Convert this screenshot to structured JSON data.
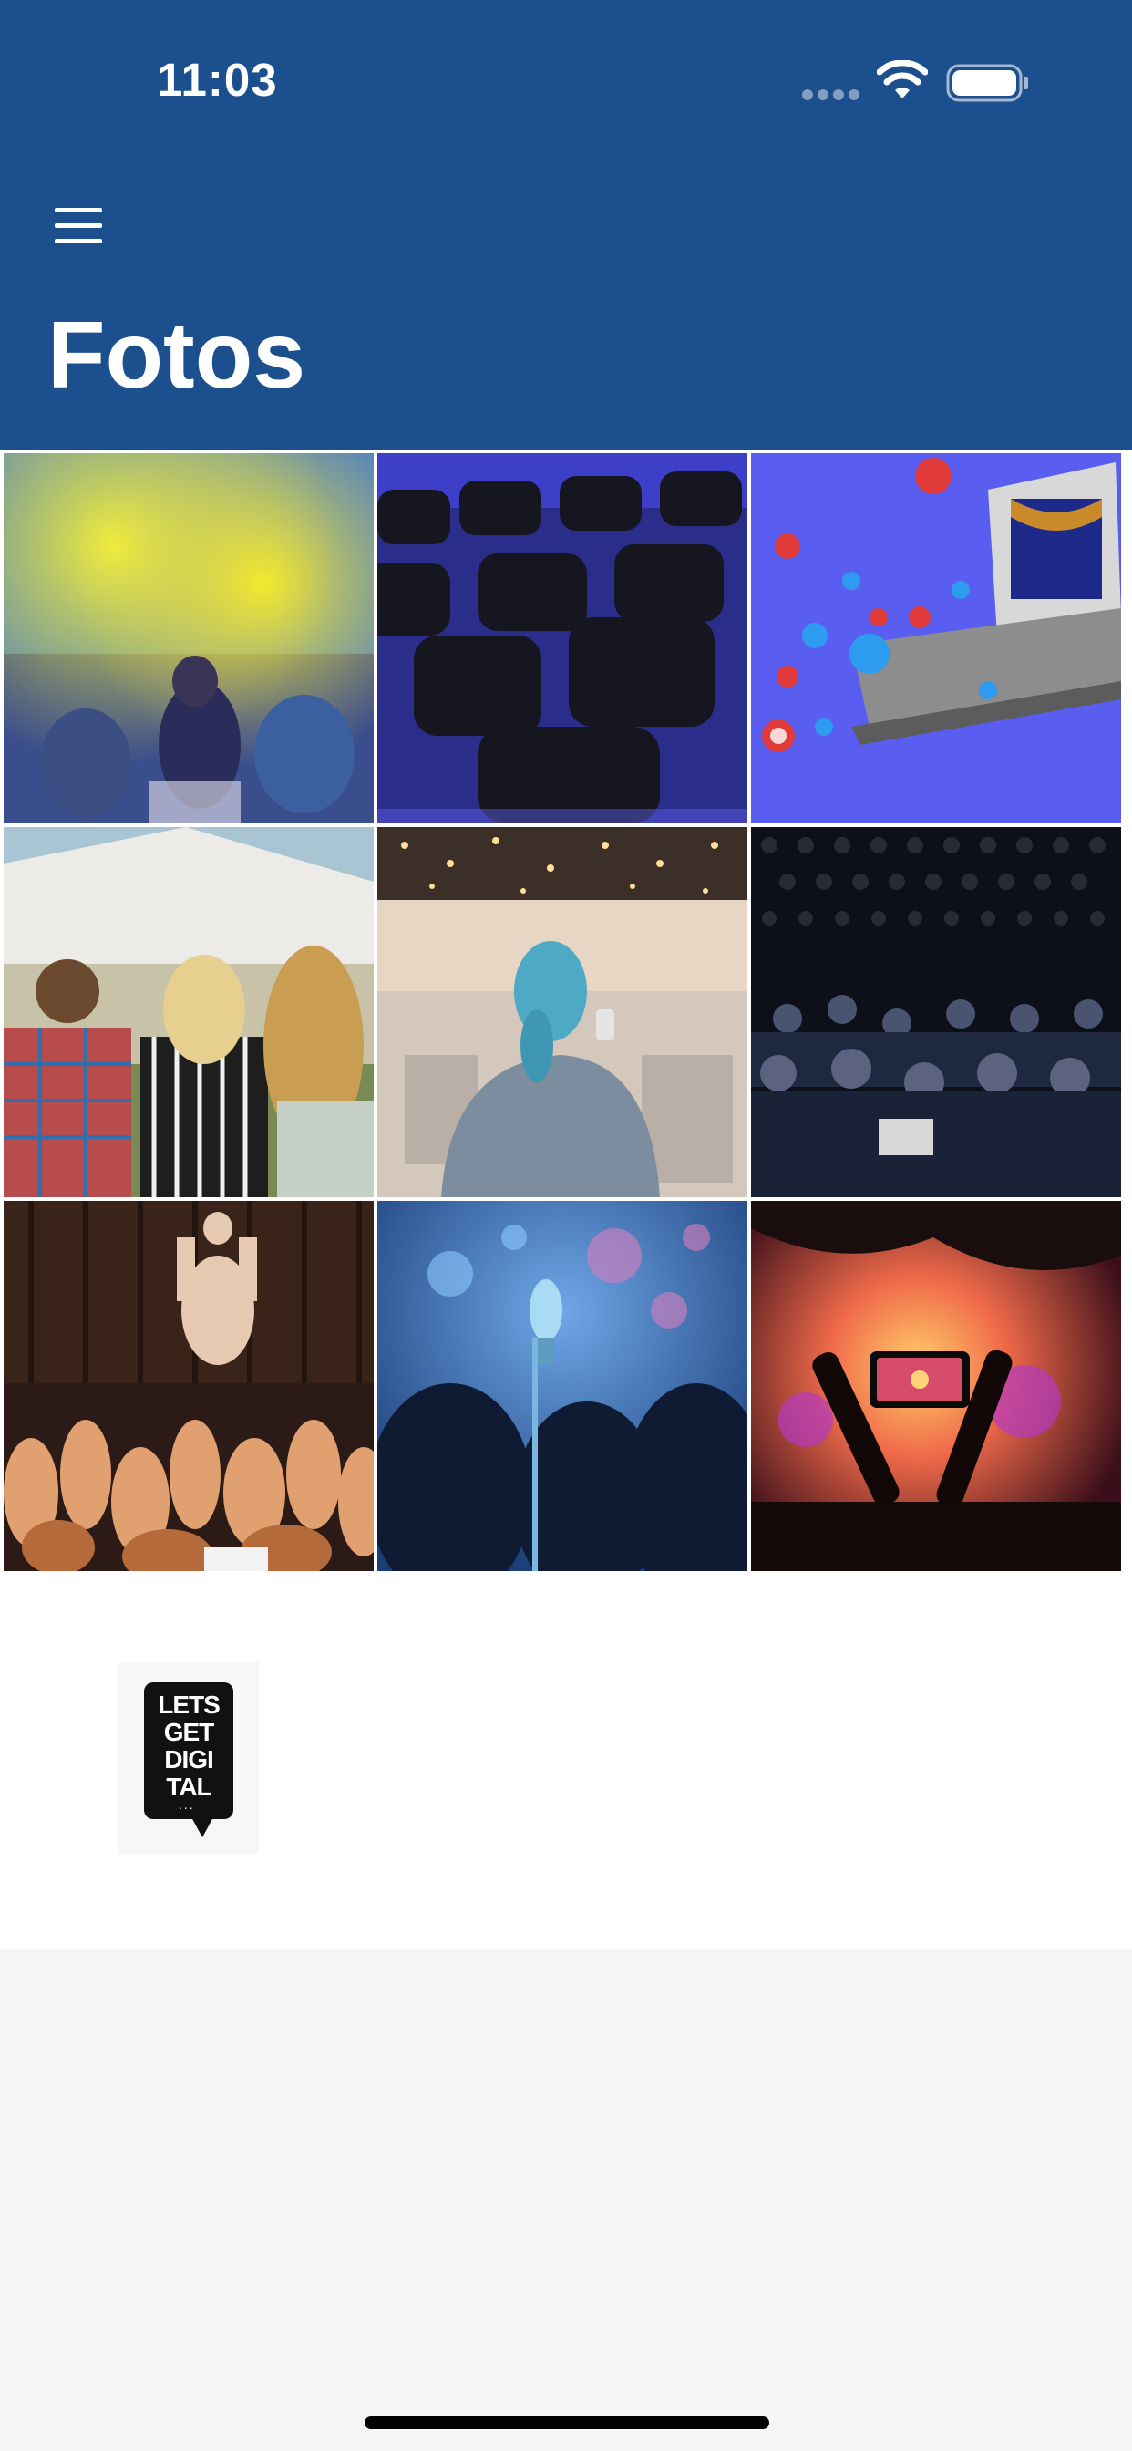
{
  "status_bar": {
    "time": "11:03",
    "icons": [
      "signal-dots-icon",
      "wifi-icon",
      "battery-icon"
    ]
  },
  "header": {
    "menu_icon": "hamburger-menu-icon",
    "title": "Fotos",
    "background": "#1c4f8e"
  },
  "gallery": {
    "photos": [
      {
        "name": "photo-color-powder-festival"
      },
      {
        "name": "photo-empty-chairs"
      },
      {
        "name": "photo-social-reactions-stage"
      },
      {
        "name": "photo-festival-crowd-tent"
      },
      {
        "name": "photo-woman-filming-event"
      },
      {
        "name": "photo-conference-audience"
      },
      {
        "name": "photo-crowd-surfing-concert"
      },
      {
        "name": "photo-microphone-stage-lights"
      },
      {
        "name": "photo-phone-recording-concert"
      }
    ]
  },
  "logo": {
    "lines": [
      "LETS",
      "GET",
      "DIGI",
      "TAL"
    ],
    "dots": "..."
  }
}
